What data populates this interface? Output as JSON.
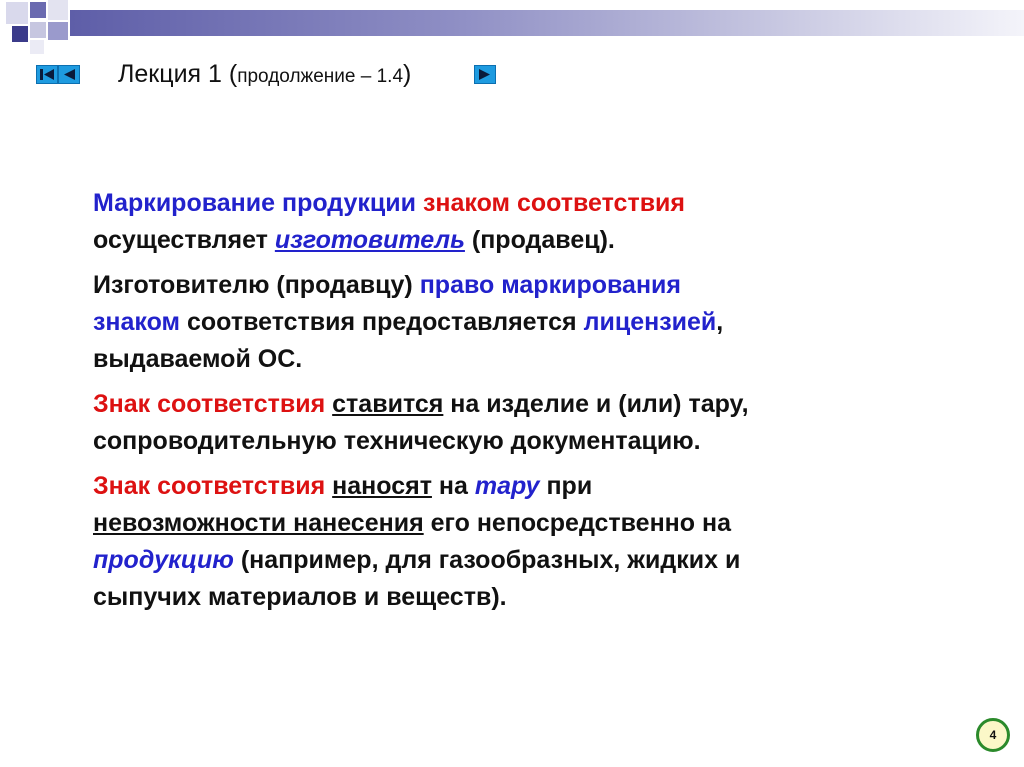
{
  "slide": {
    "title": "Лекция 1",
    "title_open_paren": " (",
    "title_sub": "продолжение – 1.4",
    "title_close_paren": ")",
    "page_number": "4"
  },
  "nav": {
    "first_icon": "skip-to-first-icon",
    "prev_icon": "play-left-icon",
    "next_icon": "play-right-icon"
  },
  "body": {
    "p1": [
      "Маркирование продукции ",
      "знаком соответствия",
      "осуществляет ",
      "изготовитель",
      " (продавец)."
    ],
    "p2": [
      "Изготовителю (продавцу) ",
      "право маркирования",
      "знаком",
      " соответствия предоставляется ",
      "лицензией",
      ",",
      "выдаваемой ОС."
    ],
    "p3": [
      "Знак соответствия",
      " ",
      "ставится",
      " на изделие и (или) тару,",
      "сопроводительную техническую документацию."
    ],
    "p4": [
      "Знак соответствия",
      " ",
      "наносят",
      " на ",
      "тару",
      " при",
      "невозможности нанесения",
      " его непосредственно на",
      "продукцию",
      " (например, для газообразных, жидких и",
      "сыпучих материалов и веществ)."
    ]
  },
  "colors": {
    "blue_text": "#2222cc",
    "red_text": "#dd1111",
    "nav_button": "#1e9be0",
    "page_badge_border": "#2b8a2b",
    "page_badge_fill": "#fbf7c8"
  }
}
